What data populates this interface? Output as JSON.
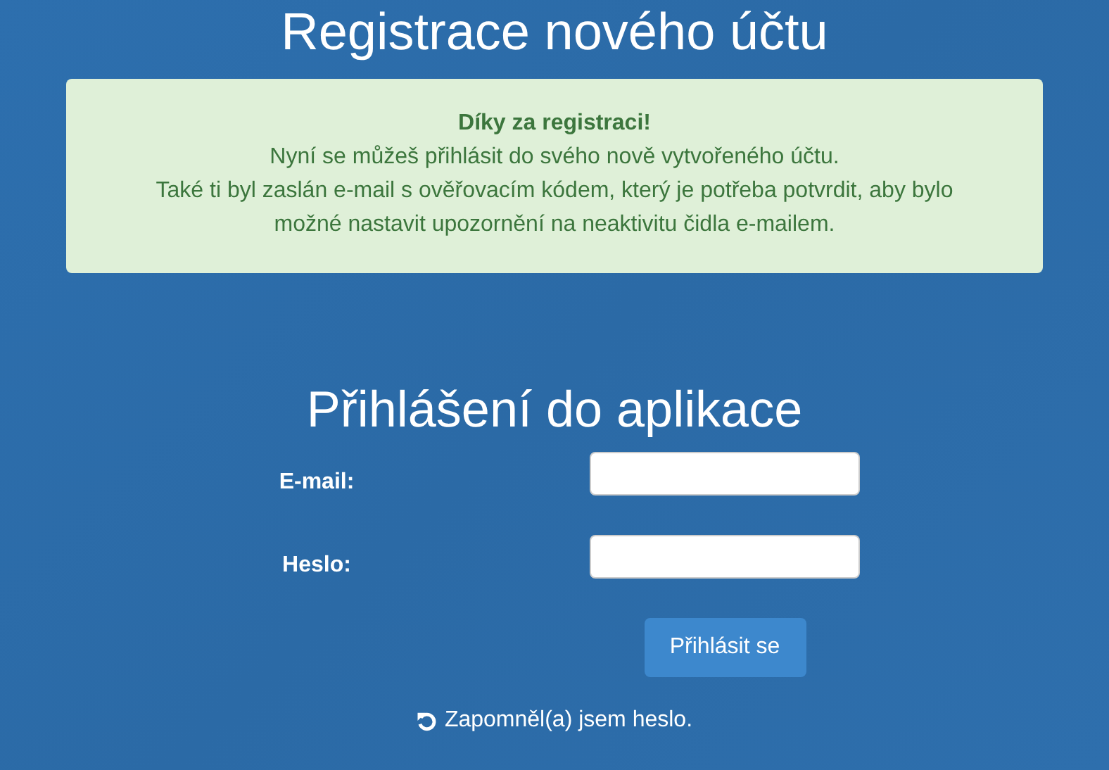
{
  "page_title": "Registrace nového účtu",
  "alert": {
    "heading": "Díky za registraci!",
    "lines": [
      "Nyní se můžeš přihlásit do svého nově vytvořeného účtu.",
      "Také ti byl zaslán e-mail s ověřovacím kódem, který je potřeba potvrdit, aby bylo možné nastavit upozornění na neaktivitu čidla e-mailem."
    ]
  },
  "login": {
    "title": "Přihlášení do aplikace",
    "fields": [
      {
        "label": "E-mail:"
      },
      {
        "label": "Heslo:"
      }
    ],
    "submit": "Přihlásit se",
    "forgot_link": "Zapomněl(a) jsem heslo."
  }
}
